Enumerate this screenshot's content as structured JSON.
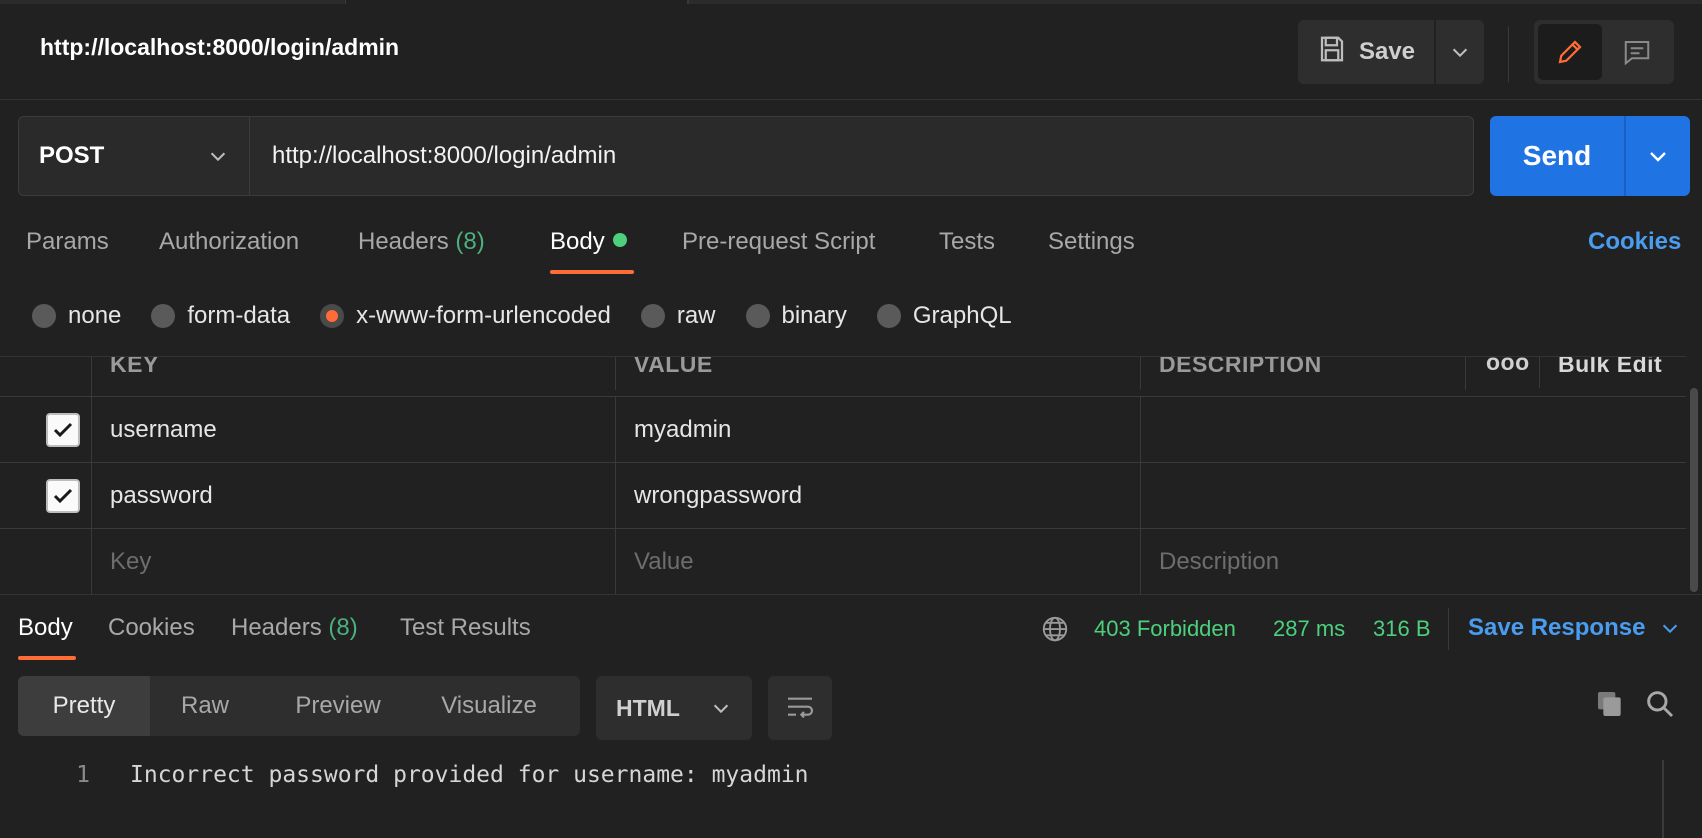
{
  "request": {
    "title": "http://localhost:8000/login/admin",
    "method": "POST",
    "url": "http://localhost:8000/login/admin"
  },
  "toolbar": {
    "save_label": "Save",
    "send_label": "Send"
  },
  "request_tabs": [
    {
      "label": "Params"
    },
    {
      "label": "Authorization"
    },
    {
      "label": "Headers",
      "count": "(8)"
    },
    {
      "label": "Body"
    },
    {
      "label": "Pre-request Script"
    },
    {
      "label": "Tests"
    },
    {
      "label": "Settings"
    }
  ],
  "cookies_link": "Cookies",
  "body_types": [
    {
      "label": "none"
    },
    {
      "label": "form-data"
    },
    {
      "label": "x-www-form-urlencoded",
      "selected": true
    },
    {
      "label": "raw"
    },
    {
      "label": "binary"
    },
    {
      "label": "GraphQL"
    }
  ],
  "table": {
    "headers": {
      "key": "KEY",
      "value": "VALUE",
      "description": "DESCRIPTION",
      "bulk_edit": "Bulk Edit",
      "more": "ooo"
    },
    "rows": [
      {
        "key": "username",
        "value": "myadmin",
        "description": "",
        "checked": true
      },
      {
        "key": "password",
        "value": "wrongpassword",
        "description": "",
        "checked": true
      }
    ],
    "placeholder": {
      "key": "Key",
      "value": "Value",
      "description": "Description"
    }
  },
  "response": {
    "tabs": [
      {
        "label": "Body"
      },
      {
        "label": "Cookies"
      },
      {
        "label": "Headers",
        "count": "(8)"
      },
      {
        "label": "Test Results"
      }
    ],
    "status": "403 Forbidden",
    "time": "287 ms",
    "size": "316 B",
    "save_response": "Save Response",
    "views": [
      "Pretty",
      "Raw",
      "Preview",
      "Visualize"
    ],
    "language": "HTML",
    "lines": [
      {
        "number": "1",
        "text": "Incorrect password provided for username: myadmin"
      }
    ]
  },
  "colors": {
    "accent_orange": "#ff6c37",
    "send_blue": "#1f73e2",
    "link_blue": "#4a9cf0",
    "status_green": "#4cd07d"
  }
}
